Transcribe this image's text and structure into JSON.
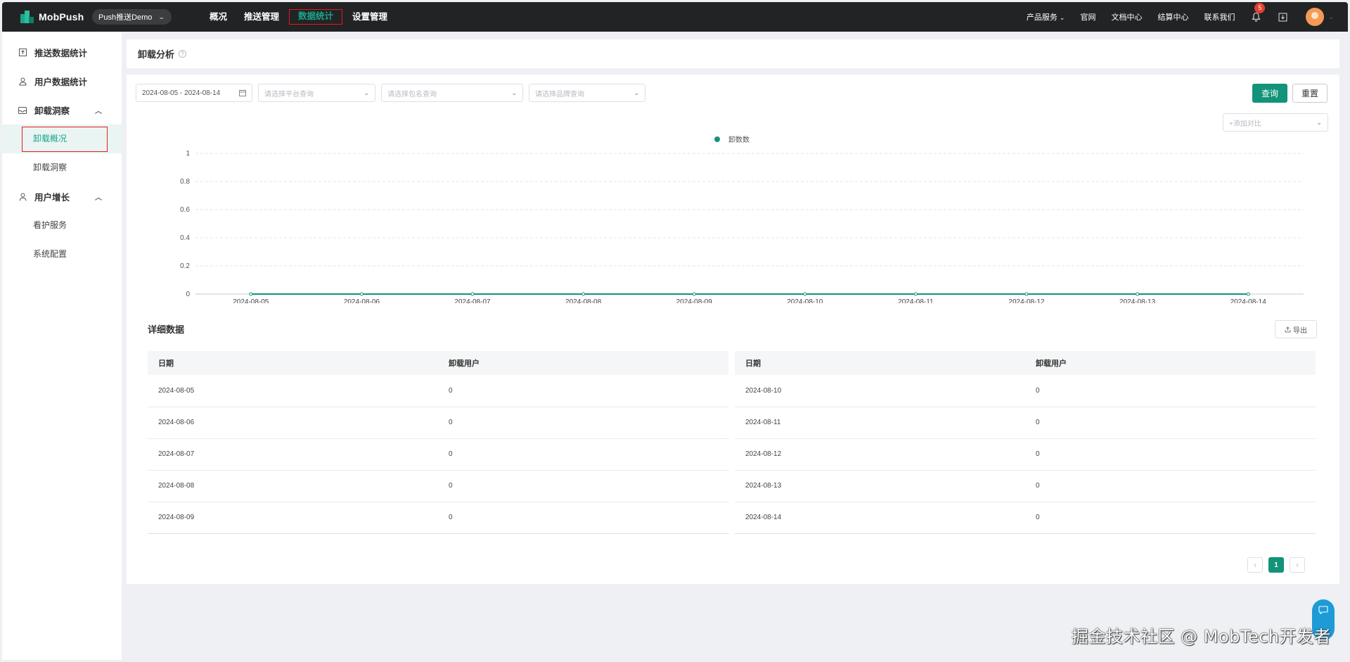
{
  "topbar": {
    "logo_text": "MobPush",
    "app_select": "Push推送Demo",
    "nav": [
      "概况",
      "推送管理",
      "数据统计",
      "设置管理"
    ],
    "active_nav_index": 2,
    "right_links": [
      "产品服务",
      "官网",
      "文档中心",
      "结算中心",
      "联系我们"
    ],
    "notification_count": "5"
  },
  "sidebar": {
    "groups": [
      {
        "label": "推送数据统计",
        "icon": "upload-box-icon"
      },
      {
        "label": "用户数据统计",
        "icon": "user-icon"
      },
      {
        "label": "卸载洞察",
        "icon": "inbox-icon",
        "expanded": true,
        "children": [
          "卸载概况",
          "卸载洞察"
        ]
      },
      {
        "label": "用户增长",
        "icon": "person-icon",
        "expanded": true,
        "children": [
          "看护服务",
          "系统配置"
        ]
      }
    ],
    "active_child": "卸载概况"
  },
  "page": {
    "title": "卸载分析"
  },
  "filters": {
    "date_range": "2024-08-05 - 2024-08-14",
    "platform_placeholder": "请选择平台查询",
    "package_placeholder": "请选择包名查询",
    "brand_placeholder": "请选择品牌查询",
    "query_label": "查询",
    "reset_label": "重置",
    "compare_placeholder": "+添加对比"
  },
  "chart_data": {
    "type": "line",
    "legend": [
      "卸数数"
    ],
    "legend_position": "top-center",
    "x": [
      "2024-08-05",
      "2024-08-06",
      "2024-08-07",
      "2024-08-08",
      "2024-08-09",
      "2024-08-10",
      "2024-08-11",
      "2024-08-12",
      "2024-08-13",
      "2024-08-14"
    ],
    "series": [
      {
        "name": "卸数数",
        "values": [
          0,
          0,
          0,
          0,
          0,
          0,
          0,
          0,
          0,
          0
        ],
        "color": "#12937a"
      }
    ],
    "y_ticks": [
      "0",
      "0.2",
      "0.4",
      "0.6",
      "0.8",
      "1"
    ],
    "ylim": [
      0,
      1
    ],
    "grid": true
  },
  "detail": {
    "title": "详细数据",
    "export_label": "导出",
    "columns": [
      "日期",
      "卸载用户"
    ],
    "left_rows": [
      [
        "2024-08-05",
        "0"
      ],
      [
        "2024-08-06",
        "0"
      ],
      [
        "2024-08-07",
        "0"
      ],
      [
        "2024-08-08",
        "0"
      ],
      [
        "2024-08-09",
        "0"
      ]
    ],
    "right_rows": [
      [
        "2024-08-10",
        "0"
      ],
      [
        "2024-08-11",
        "0"
      ],
      [
        "2024-08-12",
        "0"
      ],
      [
        "2024-08-13",
        "0"
      ],
      [
        "2024-08-14",
        "0"
      ]
    ]
  },
  "pagination": {
    "prev": "‹",
    "current": "1",
    "next": "›"
  },
  "watermark": "掘金技术社区 @ MobTech开发者",
  "colors": {
    "accent": "#12937a",
    "topbar": "#222325",
    "highlight_box": "#e21b1b",
    "badge": "#e43f2f"
  }
}
